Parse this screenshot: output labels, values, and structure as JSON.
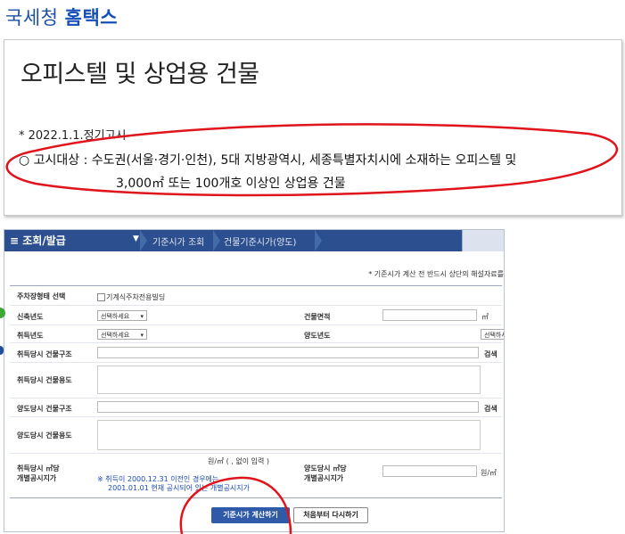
{
  "brand": {
    "prefix": "국세청",
    "name": "홈택스"
  },
  "notice": {
    "title": "오피스텔 및 상업용 건물",
    "date_line": "* 2022.1.1.정기고시",
    "target_line1": "○ 고시대상 : 수도권(서울·경기·인천), 5대 지방광역시, 세종특별자치시에 소재하는 오피스텔 및",
    "target_line2": "3,000㎡ 또는 100개호 이상인 상업용 건물",
    "highlight_color": "#e0141b"
  },
  "app": {
    "menu_label": "≡ 조회/발급",
    "crumbs": [
      "기준시가 조회",
      "건물기준시가(양도)"
    ],
    "hint": "* 기준시가 계산 전 반드시 상단의 해설자료를",
    "theme_color": "#2b4f8f"
  },
  "form": {
    "parking_label": "주차장형태 선택",
    "parking_option": "기계식주차전용빌딩",
    "new_year_label": "신축년도",
    "new_year_value": "선택하세요",
    "area_label": "건물면적",
    "area_unit": "㎡",
    "acq_year_label": "취득년도",
    "acq_year_value": "선택하세요",
    "transfer_year_label": "양도년도",
    "transfer_year_value": "선택하세요",
    "acq_structure_label": "취득당시 건물구조",
    "search_label": "검색",
    "acq_use_label": "취득당시 건물용도",
    "transfer_structure_label": "양도당시 건물구조",
    "transfer_use_label": "양도당시 건물용도",
    "acq_price_label_1": "취득당시 ㎡당",
    "acq_price_label_2": "개별공시지가",
    "acq_price_hint": "원/㎡ ( , 없이 입력 )",
    "acq_note_1": "※ 취득이 2000.12.31 이전인 경우에는",
    "acq_note_2": "2001.01.01 현재 공시되어 있는 개별공시지가",
    "transfer_price_label_1": "양도당시 ㎡당",
    "transfer_price_label_2": "개별공시지가",
    "price_unit": "원/㎡"
  },
  "buttons": {
    "calculate": "기준시가 계산하기",
    "reset": "처음부터 다시하기"
  }
}
